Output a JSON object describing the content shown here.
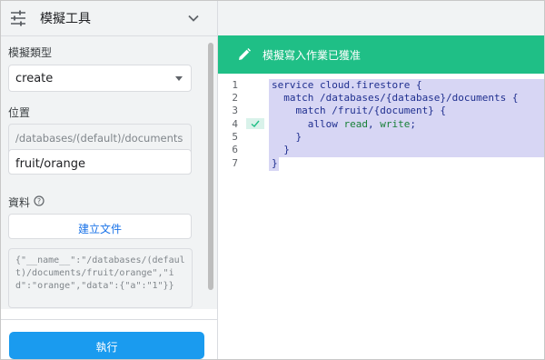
{
  "panel": {
    "title": "模擬工具",
    "simulation_type_label": "模擬類型",
    "simulation_type_value": "create",
    "location_label": "位置",
    "location_prefix": "/databases/(default)/documents",
    "location_value": "fruit/orange",
    "data_label": "資料",
    "create_doc_button": "建立文件",
    "json_preview": "{\"__name__\":\"/databases/(default)/documents/fruit/orange\",\"id\":\"orange\",\"data\":{\"a\":\"1\"}}",
    "run_button": "執行"
  },
  "banner": {
    "text": "模擬寫入作業已獲准",
    "color": "#1fbf86"
  },
  "editor": {
    "line_numbers": [
      "1",
      "2",
      "3",
      "4",
      "5",
      "6",
      "7"
    ],
    "lines": {
      "l1": "service cloud.firestore {",
      "l2": "  match /databases/{database}/documents {",
      "l3": "    match /fruit/{document} {",
      "l4_indent": "      ",
      "l4_kw": "allow ",
      "l4_read": "read",
      "l4_sep": ", ",
      "l4_write": "write",
      "l4_end": ";",
      "l5": "    }",
      "l6": "  }",
      "l7": "}"
    },
    "highlight_color": "#d7d6f4"
  },
  "accent_color": "#1a9bef",
  "icons": [
    "tune-icon",
    "chevron-down-icon",
    "caret-down-icon",
    "help-icon",
    "pencil-icon",
    "check-icon"
  ]
}
